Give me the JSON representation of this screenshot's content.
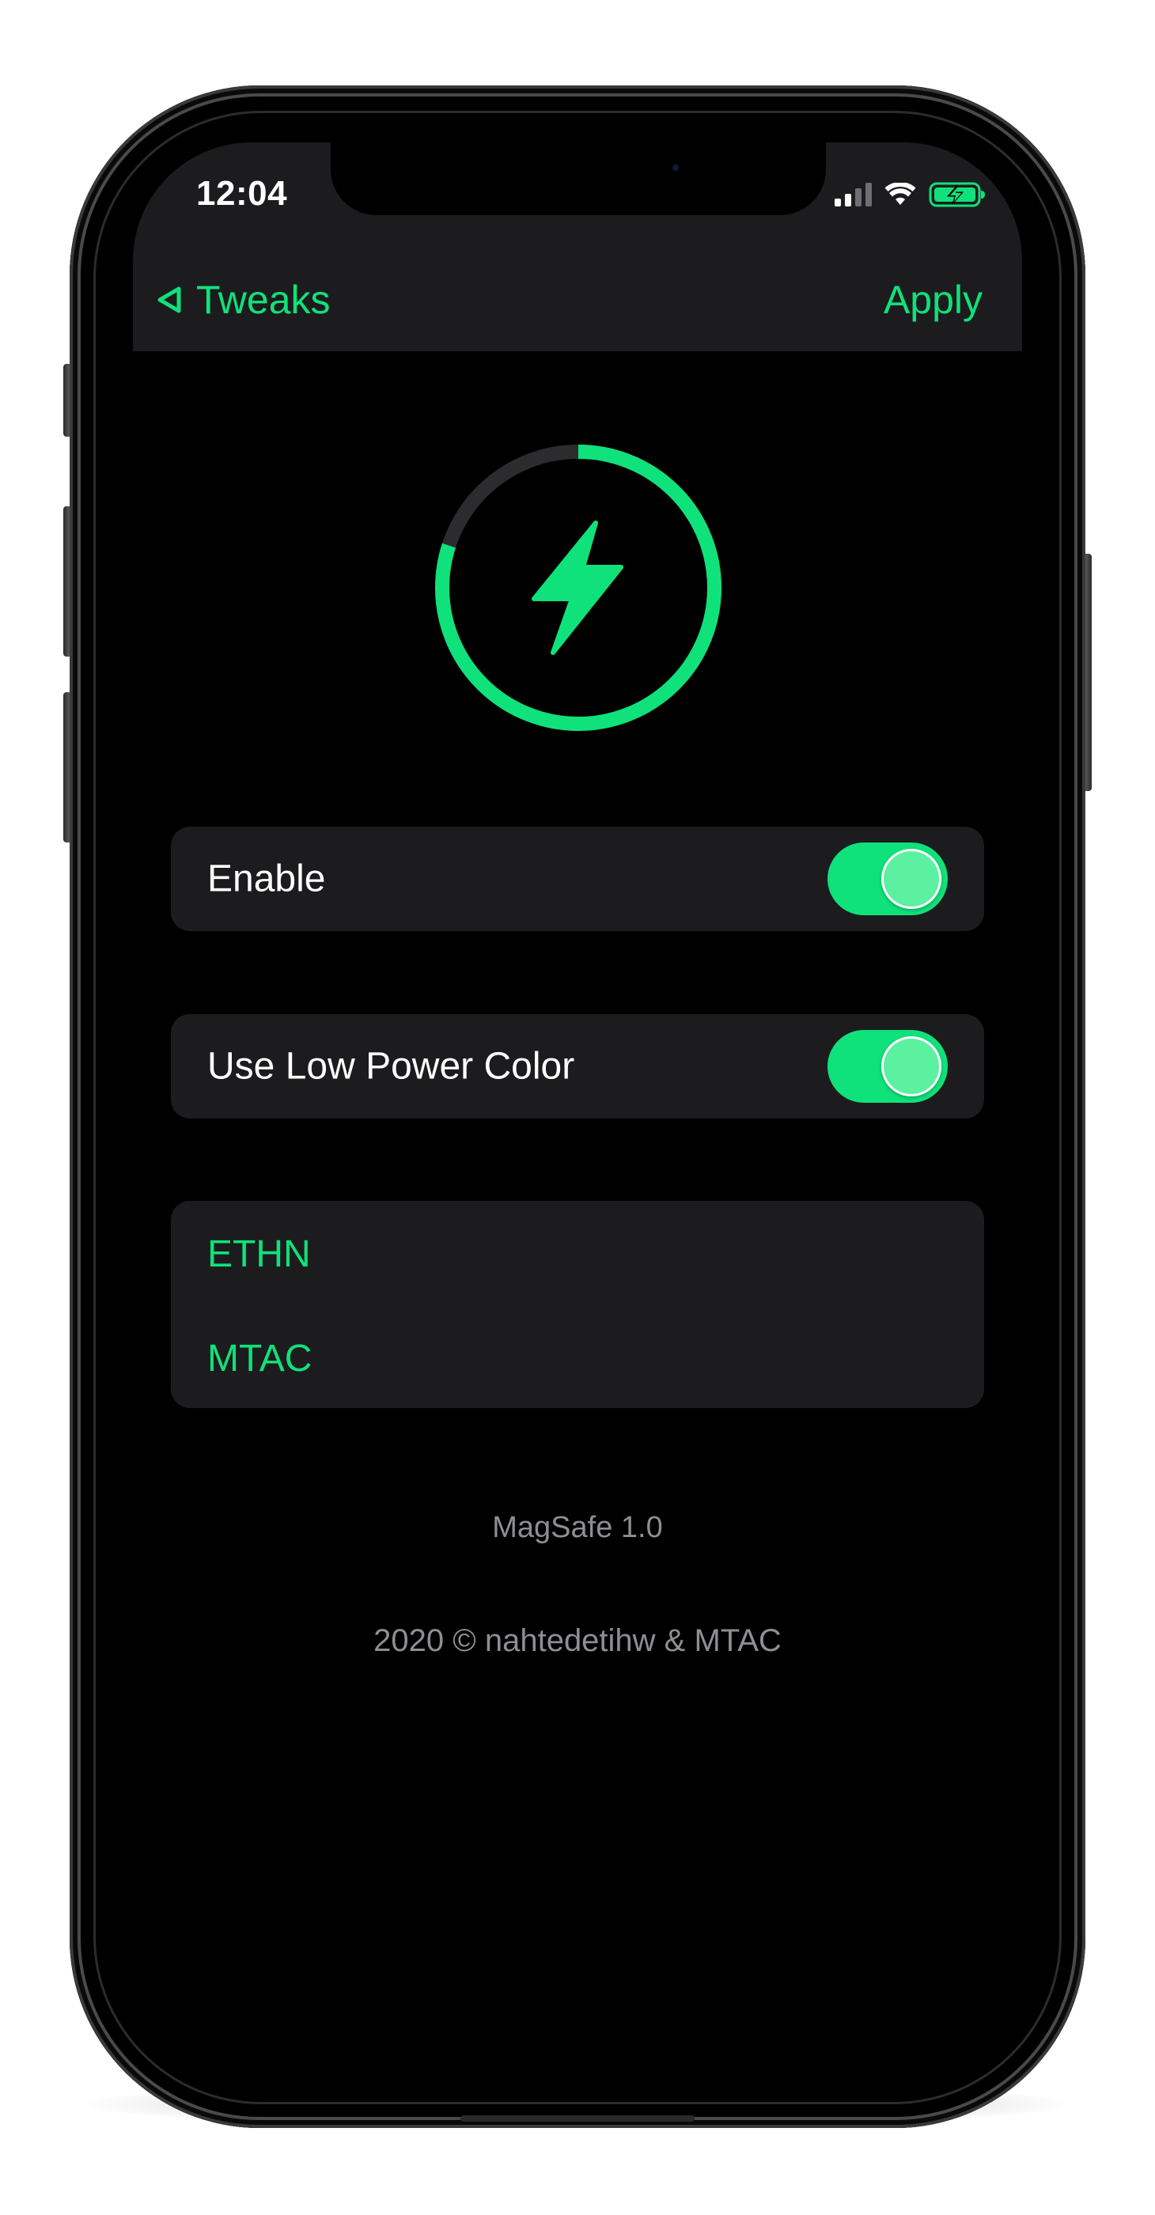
{
  "colors": {
    "accent": "#0fe27a",
    "background": "#000000",
    "card": "#1c1c1e",
    "secondary_text": "#8e8e93"
  },
  "status_bar": {
    "time": "12:04",
    "icons": [
      "cellular-signal-icon",
      "wifi-icon",
      "battery-charging-icon"
    ]
  },
  "nav": {
    "back_label": "Tweaks",
    "back_icon": "back-triangle-icon",
    "apply_label": "Apply"
  },
  "hero": {
    "icon": "lightning-bolt-icon",
    "ring_fill_fraction": 0.8
  },
  "settings": [
    {
      "label": "Enable",
      "on": true
    },
    {
      "label": "Use Low Power Color",
      "on": true
    }
  ],
  "links": [
    "ETHN",
    "MTAC"
  ],
  "footer": {
    "version": "MagSafe 1.0",
    "copyright": "2020 © nahtedetihw & MTAC"
  }
}
